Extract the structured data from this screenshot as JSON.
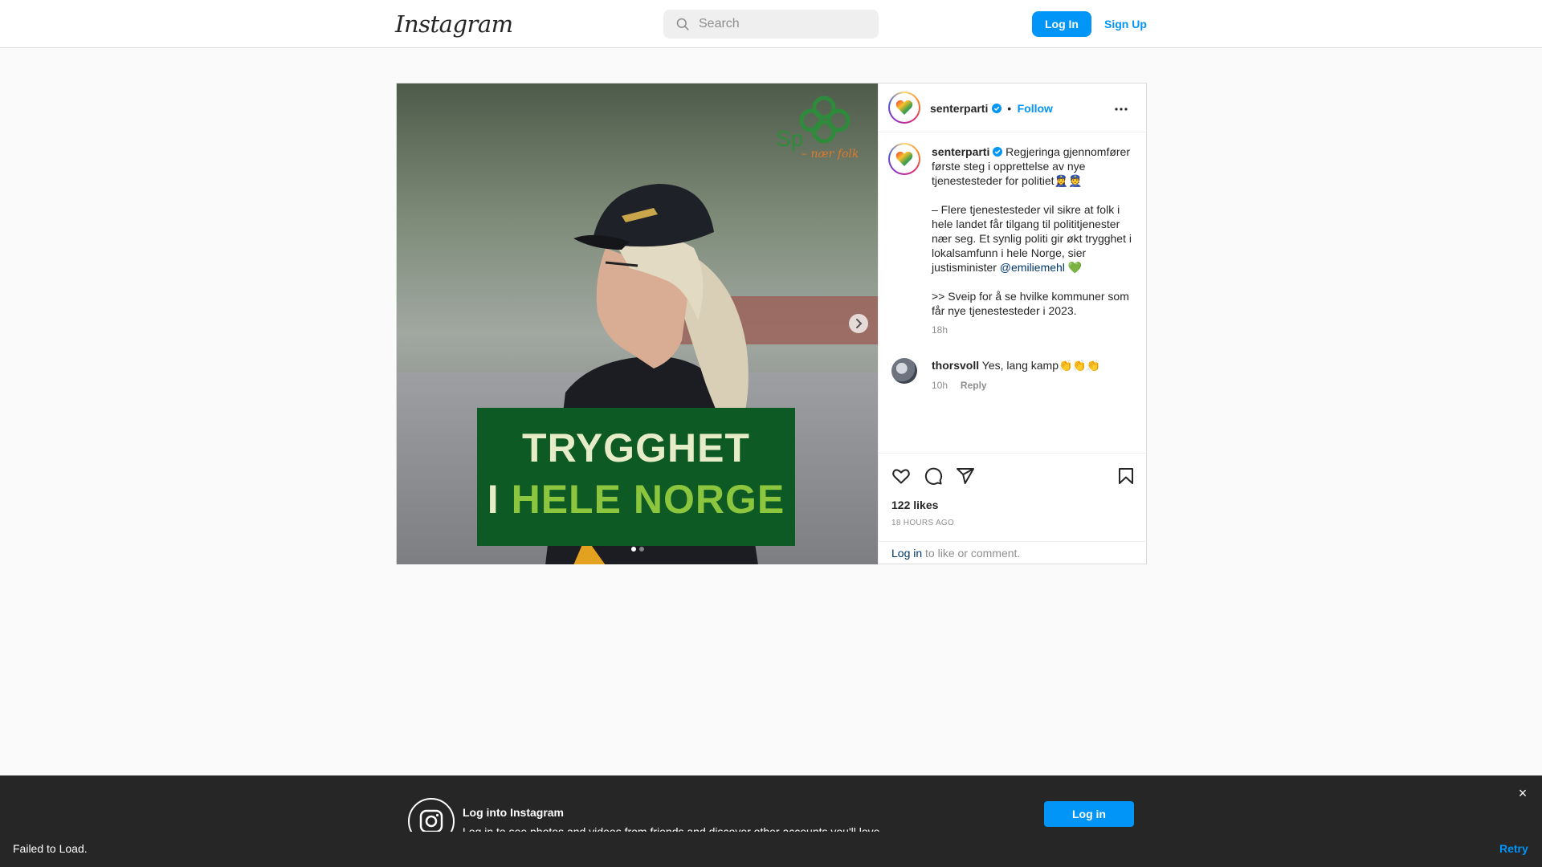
{
  "app": {
    "logo_text": "Instagram"
  },
  "nav": {
    "search_placeholder": "Search",
    "login_label": "Log In",
    "signup_label": "Sign Up"
  },
  "colors": {
    "accent": "#0095f6",
    "banner_green": "#0e5a24",
    "highlight_green": "#8cc63e"
  },
  "post": {
    "author": "senterparti",
    "verified": true,
    "separator": "•",
    "follow_label": "Follow",
    "image": {
      "headline_line1": "TRYGGHET",
      "headline_line2_prefix": "I ",
      "headline_line2_highlight": "HELE NORGE",
      "carousel_total": 2,
      "carousel_active": 1
    },
    "caption": {
      "author": "senterparti",
      "text_1": "Regjeringa gjennomfører første steg i opprettelse av nye tjenestesteder for politiet👮‍♀️👮\n\n– Flere tjenestesteder vil sikre at folk i hele landet får tilgang til polititjenester nær seg. Et synlig politi gir økt trygghet i lokalsamfunn i hele Norge, sier justisminister ",
      "mention": "@emiliemehl",
      "text_2": " 💚\n\n>> Sveip for å se hvilke kommuner som får nye tjenestesteder i 2023.",
      "time": "18h"
    },
    "comments": [
      {
        "user": "thorsvoll",
        "text": "Yes, lang kamp👏👏👏",
        "time": "10h",
        "reply_label": "Reply"
      }
    ],
    "likes": "122 likes",
    "ago": "18 HOURS AGO",
    "login_prompt_link": "Log in",
    "login_prompt_rest": " to like or comment."
  },
  "bottom_banner": {
    "title": "Log into Instagram",
    "subtitle": "Log in to see photos and videos from friends and discover other accounts you'll love.",
    "login_label": "Log in",
    "close_glyph": "×"
  },
  "error_bar": {
    "message": "Failed to Load.",
    "retry_label": "Retry"
  }
}
